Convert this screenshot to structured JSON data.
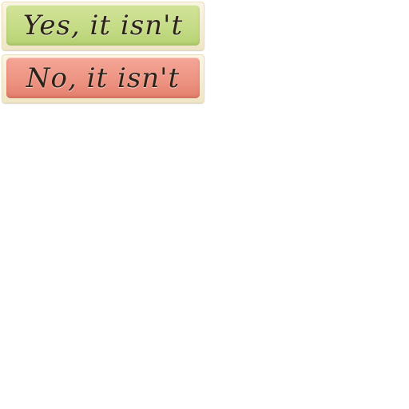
{
  "answers": {
    "yes": {
      "label": "Yes, it isn't",
      "color": "#c5dc86"
    },
    "no": {
      "label": "No, it isn't",
      "color": "#ee9483"
    }
  }
}
